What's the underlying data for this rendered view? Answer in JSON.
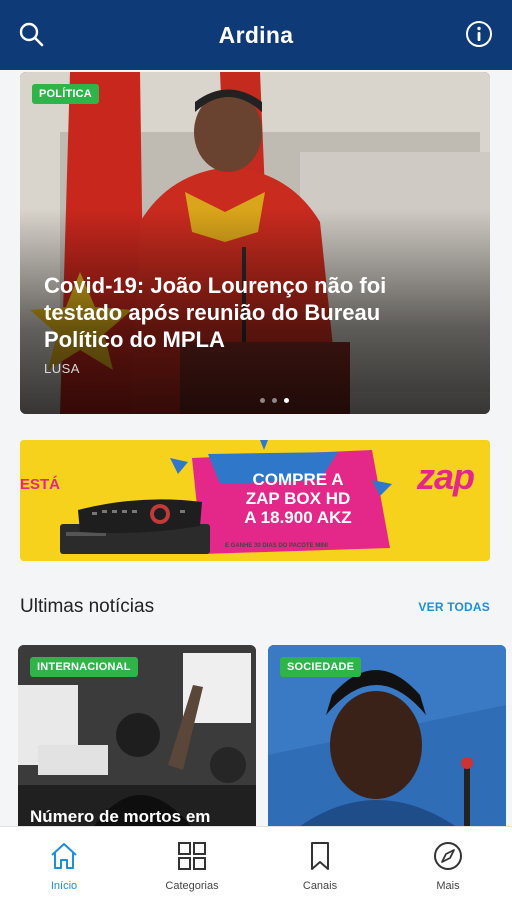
{
  "app": {
    "title": "Ardina"
  },
  "header": {
    "search_icon": "search-icon",
    "info_icon": "info-icon"
  },
  "hero": {
    "category": "POLÍTICA",
    "headline": "Covid-19: João Lourenço não foi testado após reunião do Bureau Político do MPLA",
    "source": "LUSA",
    "slides_count": 3,
    "active_slide": 3
  },
  "ad": {
    "partial_text": "ESTÁ",
    "offer_line1": "COMPRE A",
    "offer_line2": "ZAP BOX HD",
    "offer_line3": "A 18.900 AKZ",
    "brand": "zap",
    "fine_print": "E GANHE 30 DIAS DO PACOTE MINI"
  },
  "latest": {
    "title": "Ultimas notícias",
    "see_all": "VER TODAS",
    "items": [
      {
        "category": "INTERNACIONAL",
        "title": "Número de mortos em"
      },
      {
        "category": "SOCIEDADE",
        "title": ""
      }
    ]
  },
  "bottom_nav": {
    "items": [
      {
        "label": "Início",
        "icon": "home-icon",
        "active": true
      },
      {
        "label": "Categorias",
        "icon": "grid-icon",
        "active": false
      },
      {
        "label": "Canais",
        "icon": "bookmark-icon",
        "active": false
      },
      {
        "label": "Mais",
        "icon": "compass-icon",
        "active": false
      }
    ]
  },
  "colors": {
    "header": "#0f3a78",
    "accent": "#1d8fd8",
    "badge": "#2fb44a",
    "ad_pink": "#e4288a",
    "ad_yellow": "#f7d21c"
  }
}
